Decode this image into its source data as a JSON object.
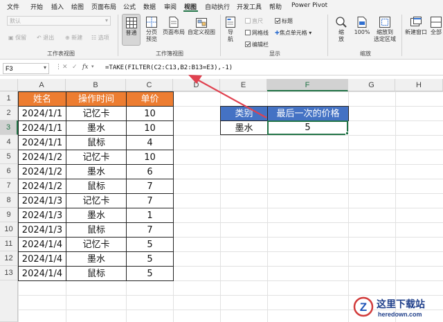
{
  "menu": {
    "items": [
      "文件",
      "开始",
      "插入",
      "绘图",
      "页面布局",
      "公式",
      "数据",
      "审阅",
      "视图",
      "自动执行",
      "开发工具",
      "帮助",
      "Power Pivot"
    ],
    "active": "视图"
  },
  "ribbon": {
    "sheet_view": {
      "dropdown": "默认",
      "keep": "保留",
      "exit": "退出",
      "new": "新建",
      "options": "选项",
      "label": "工作表视图"
    },
    "workbook_view": {
      "normal": "普通",
      "page_break": "分页\n预览",
      "page_layout": "页面布局",
      "custom": "自定义视图",
      "label": "工作簿视图"
    },
    "show": {
      "nav": "导\n航",
      "ruler": "直尺",
      "gridlines": "网格线",
      "formula_bar": "编辑栏",
      "headings": "标题",
      "focus_cell": "焦点单元格",
      "label": "显示"
    },
    "zoom": {
      "zoom": "缩\n放",
      "pct": "100%",
      "to_selection": "缩放到\n选定区域",
      "label": "缩放"
    },
    "window": {
      "new_window": "新建窗口",
      "arrange_all": "全部"
    }
  },
  "formula_bar": {
    "name_box": "F3",
    "fx": "fx",
    "formula": "=TAKE(FILTER(C2:C13,B2:B13=E3),-1)"
  },
  "columns": [
    "A",
    "B",
    "C",
    "D",
    "E",
    "F",
    "G",
    "H"
  ],
  "rows": [
    "1",
    "2",
    "3",
    "4",
    "5",
    "6",
    "7",
    "8",
    "9",
    "10",
    "11",
    "12",
    "13"
  ],
  "table": {
    "headers": [
      "姓名",
      "操作时间",
      "单价"
    ],
    "rows": [
      [
        "2024/1/1",
        "记忆卡",
        "10"
      ],
      [
        "2024/1/1",
        "墨水",
        "10"
      ],
      [
        "2024/1/1",
        "鼠标",
        "4"
      ],
      [
        "2024/1/2",
        "记忆卡",
        "10"
      ],
      [
        "2024/1/2",
        "墨水",
        "6"
      ],
      [
        "2024/1/2",
        "鼠标",
        "7"
      ],
      [
        "2024/1/3",
        "记忆卡",
        "7"
      ],
      [
        "2024/1/3",
        "墨水",
        "1"
      ],
      [
        "2024/1/3",
        "鼠标",
        "7"
      ],
      [
        "2024/1/4",
        "记忆卡",
        "5"
      ],
      [
        "2024/1/4",
        "墨水",
        "5"
      ],
      [
        "2024/1/4",
        "鼠标",
        "5"
      ]
    ]
  },
  "lookup": {
    "header_category": "类别",
    "header_price": "最后一次的价格",
    "category": "墨水",
    "result": "5"
  },
  "watermark": {
    "site_name": "这里下载站",
    "site_url": "heredown.com",
    "site_glyph": "Z"
  },
  "colors": {
    "accent": "#217346",
    "orange_header": "#ed7d31",
    "blue_header": "#4472c4",
    "arrow": "#e0414f"
  }
}
